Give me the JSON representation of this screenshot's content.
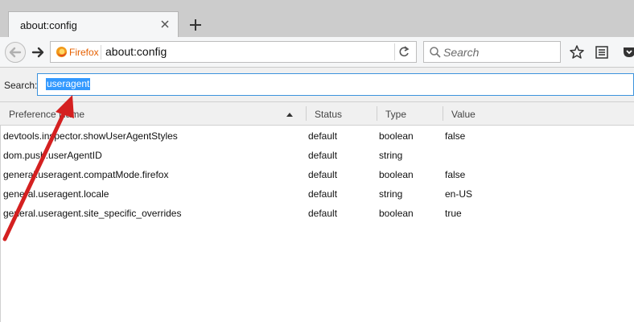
{
  "tab": {
    "title": "about:config"
  },
  "nav": {
    "identity_label": "Firefox",
    "url": "about:config",
    "search_placeholder": "Search"
  },
  "filter": {
    "label": "Search:",
    "value": "useragent"
  },
  "columns": [
    "Preference Name",
    "Status",
    "Type",
    "Value"
  ],
  "rows": [
    {
      "name": "devtools.inspector.showUserAgentStyles",
      "status": "default",
      "type": "boolean",
      "value": "false"
    },
    {
      "name": "dom.push.userAgentID",
      "status": "default",
      "type": "string",
      "value": ""
    },
    {
      "name": "general.useragent.compatMode.firefox",
      "status": "default",
      "type": "boolean",
      "value": "false"
    },
    {
      "name": "general.useragent.locale",
      "status": "default",
      "type": "string",
      "value": "en-US"
    },
    {
      "name": "general.useragent.site_specific_overrides",
      "status": "default",
      "type": "boolean",
      "value": "true"
    }
  ],
  "colors": {
    "accent": "#3399ff",
    "filter_border": "#3c93dd",
    "firefox_label": "#e66000",
    "annotation_arrow": "#d42020"
  }
}
